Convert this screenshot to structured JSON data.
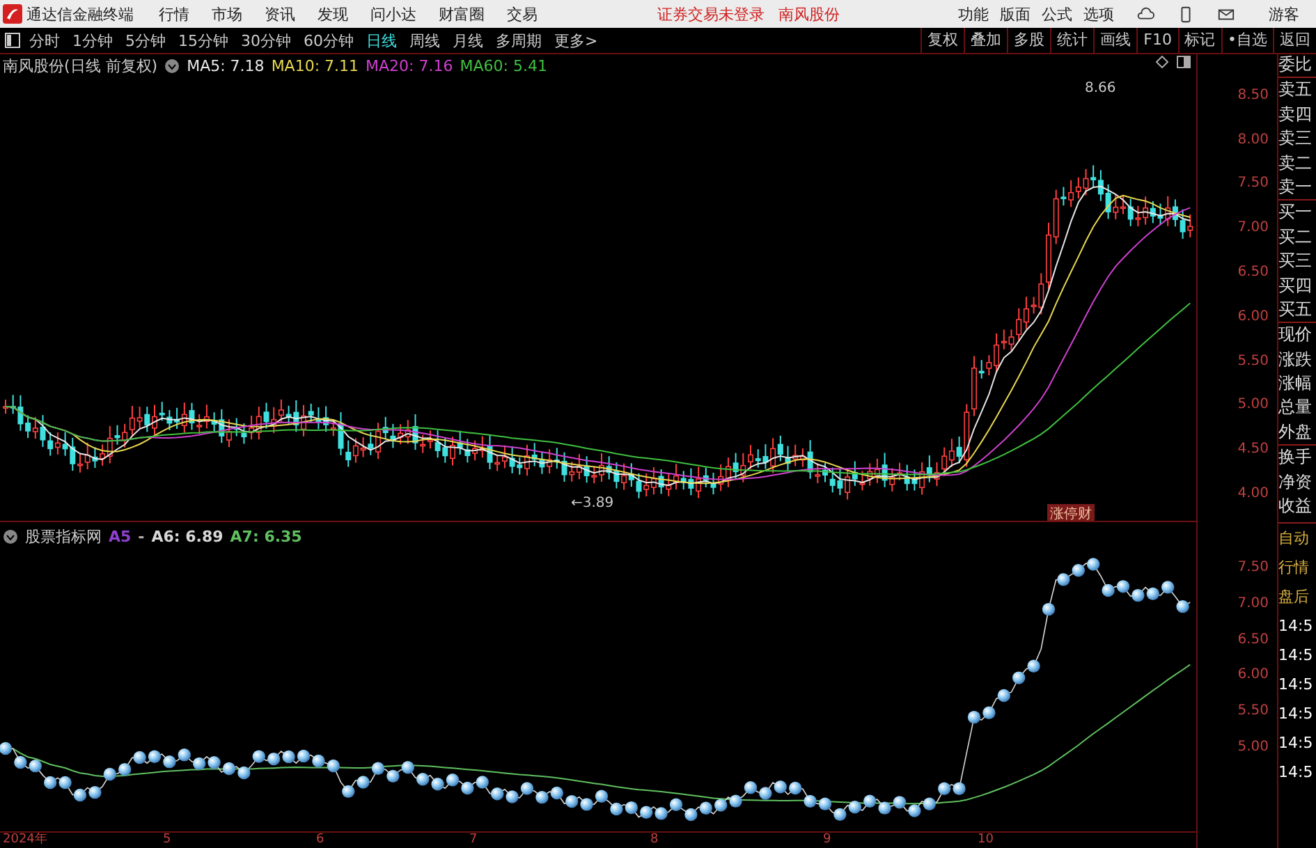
{
  "title_bar": {
    "app_name": "通达信金融终端",
    "menu": [
      "行情",
      "市场",
      "资讯",
      "发现",
      "问小达",
      "财富圈",
      "交易"
    ],
    "notices": [
      "证券交易未登录",
      "南风股份"
    ],
    "tools": [
      "功能",
      "版面",
      "公式",
      "选项"
    ],
    "user": "游客"
  },
  "toolbar": {
    "periods": [
      {
        "label": "分时",
        "selected": false
      },
      {
        "label": "1分钟",
        "selected": false
      },
      {
        "label": "5分钟",
        "selected": false
      },
      {
        "label": "15分钟",
        "selected": false
      },
      {
        "label": "30分钟",
        "selected": false
      },
      {
        "label": "60分钟",
        "selected": false
      },
      {
        "label": "日线",
        "selected": true
      },
      {
        "label": "周线",
        "selected": false
      },
      {
        "label": "月线",
        "selected": false
      },
      {
        "label": "多周期",
        "selected": false
      },
      {
        "label": "更多>",
        "selected": false
      }
    ],
    "buttons": [
      "复权",
      "叠加",
      "多股",
      "统计",
      "画线",
      "F10",
      "标记",
      "•自选",
      "返回"
    ]
  },
  "main_chart": {
    "title": "南风股份(日线 前复权)",
    "averages": [
      {
        "label": "MA5: 7.18",
        "color": "#e8e8e8"
      },
      {
        "label": "MA10: 7.11",
        "color": "#e8d850"
      },
      {
        "label": "MA20: 7.16",
        "color": "#d040d0"
      },
      {
        "label": "MA60: 5.41",
        "color": "#40c040"
      }
    ],
    "high_label": "8.66",
    "low_label": "←3.89",
    "badge": "涨停财",
    "y_ticks": [
      "8.50",
      "8.00",
      "7.50",
      "7.00",
      "6.50",
      "6.00",
      "5.50",
      "5.00",
      "4.50",
      "4.00"
    ]
  },
  "indicator": {
    "title": "股票指标网",
    "series": [
      {
        "label": "A5",
        "color": "#9040d0"
      },
      {
        "label": "-",
        "color": "#b0b0b0"
      },
      {
        "label": "A6: 6.89",
        "color": "#d8d8d8"
      },
      {
        "label": "A7: 6.35",
        "color": "#60c060"
      }
    ],
    "y_ticks": [
      "7.50",
      "7.00",
      "6.50",
      "6.00",
      "5.50",
      "5.00"
    ]
  },
  "x_axis": [
    "2024年",
    "5",
    "6",
    "7",
    "8",
    "9",
    "10"
  ],
  "side_panel": {
    "quote_groups": [
      [
        "委比"
      ],
      [
        "卖五",
        "卖四",
        "卖三",
        "卖二",
        "卖一"
      ],
      [
        "买一",
        "买二",
        "买三",
        "买四",
        "买五"
      ],
      [
        "现价",
        "涨跌",
        "涨幅",
        "总量",
        "外盘"
      ],
      [
        "换手",
        "净资",
        "收益"
      ]
    ],
    "bottom_items": [
      "自动",
      "行情",
      "盘后",
      "14:5",
      "14:5",
      "14:5",
      "14:5",
      "14:5",
      "14:5"
    ]
  }
}
